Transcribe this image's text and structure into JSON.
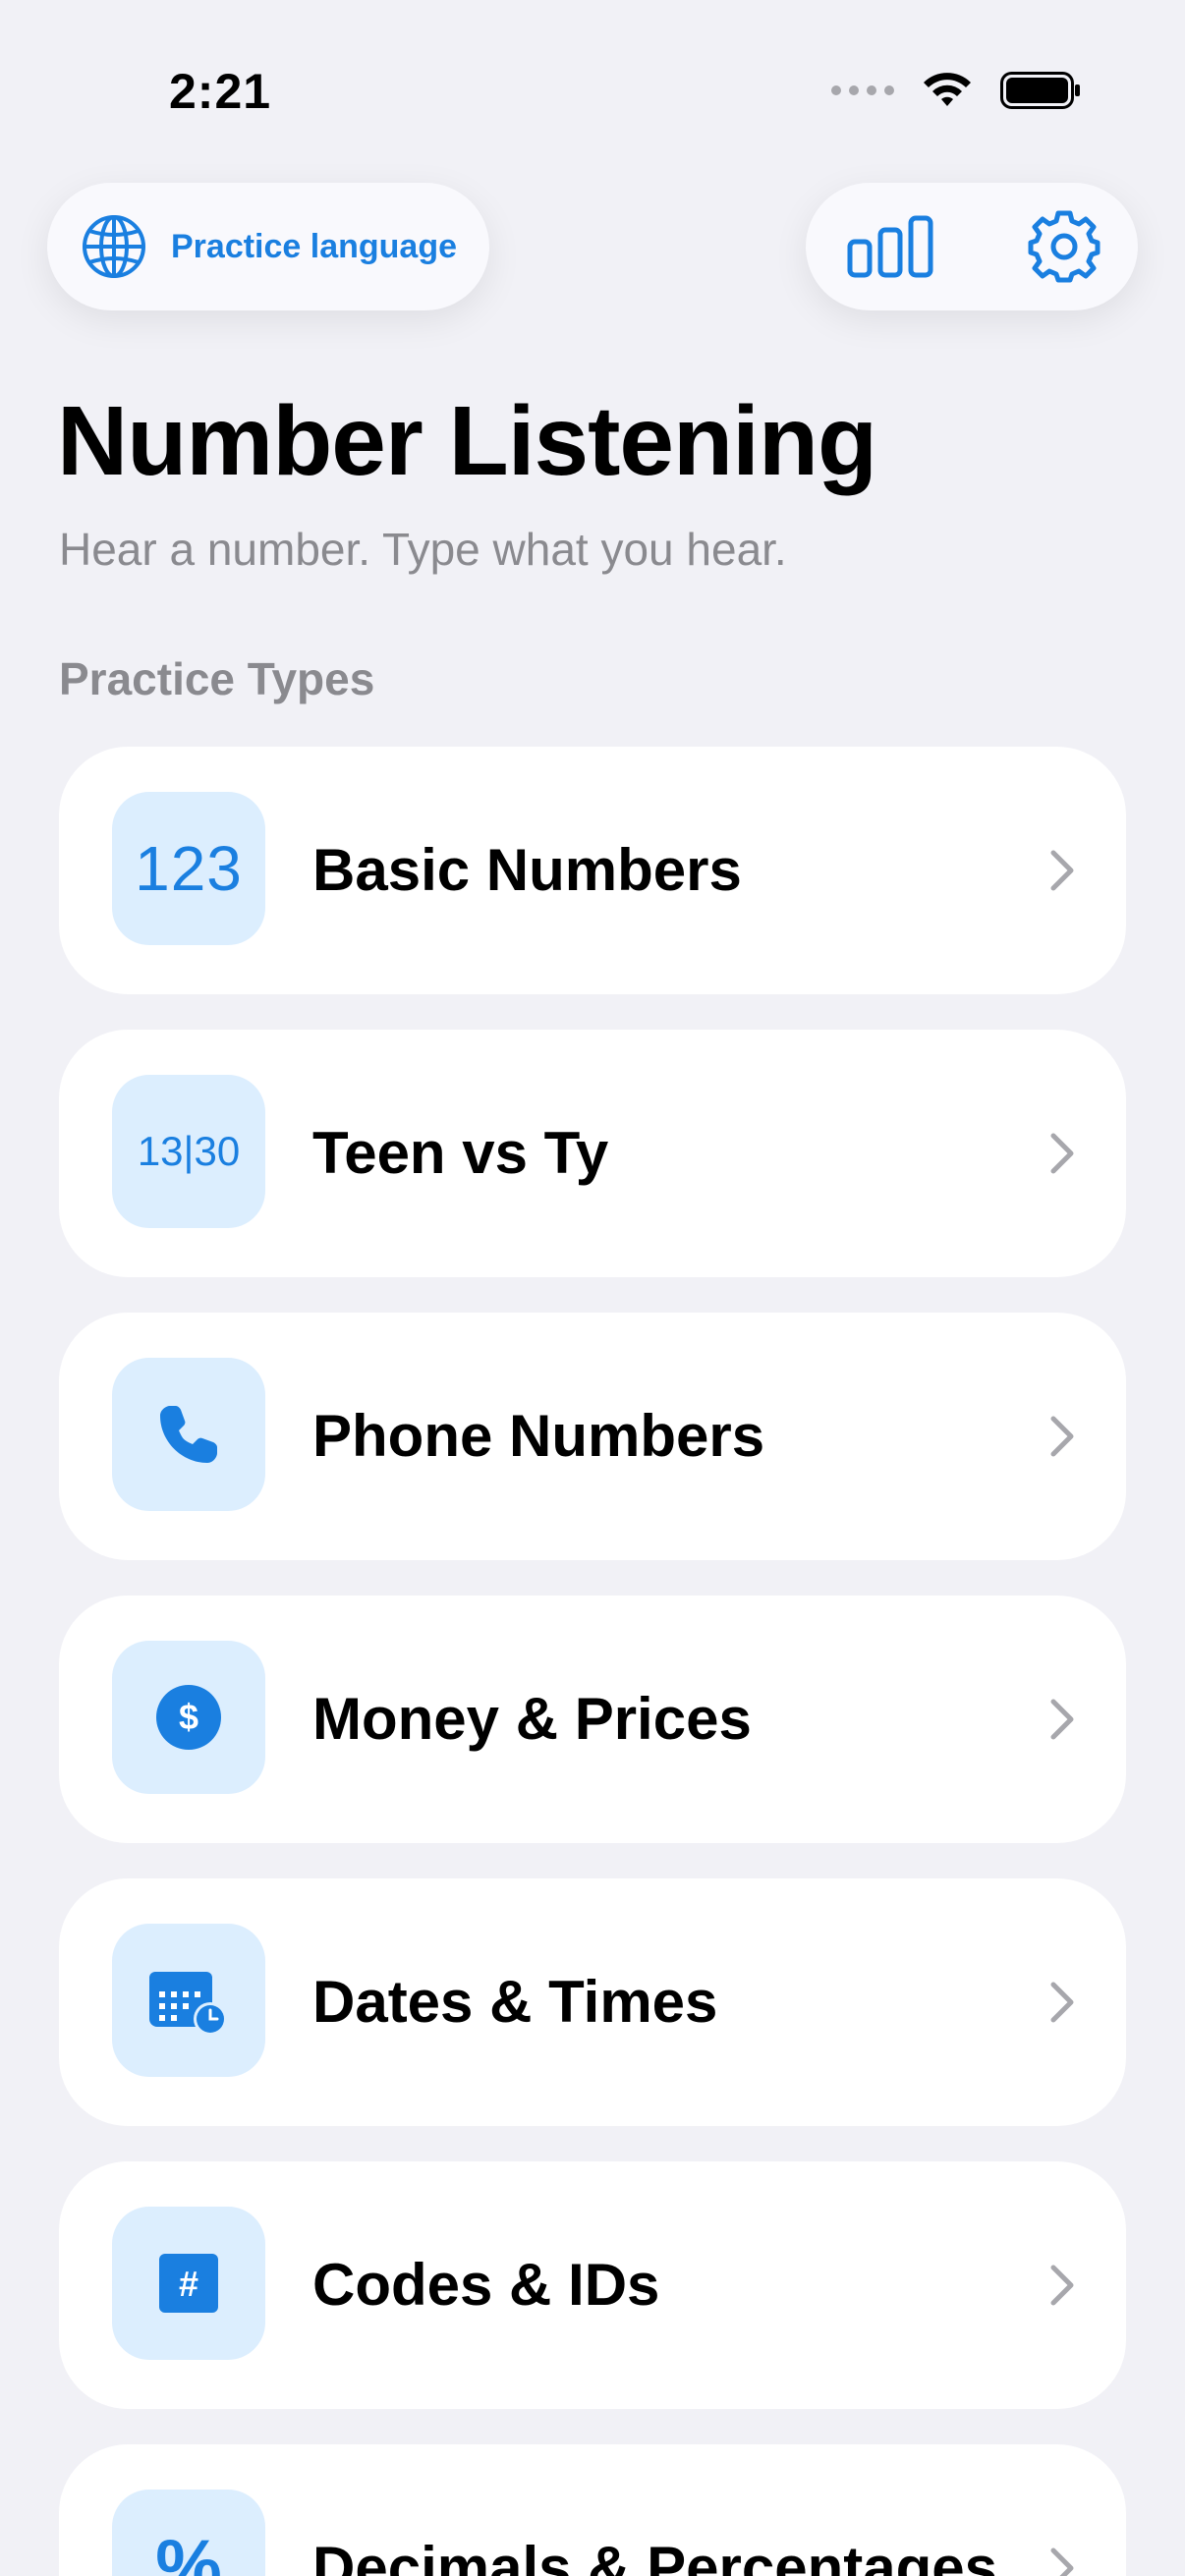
{
  "status_bar": {
    "time": "2:21"
  },
  "header": {
    "practice_language_label": "Practice language",
    "title": "Number Listening",
    "subtitle": "Hear a number. Type what you hear."
  },
  "section": {
    "title": "Practice Types"
  },
  "practice_types": [
    {
      "label": "Basic Numbers",
      "icon": "123-icon",
      "icon_text": "123"
    },
    {
      "label": "Teen vs Ty",
      "icon": "teen-vs-ty-icon",
      "icon_text": "13|30"
    },
    {
      "label": "Phone Numbers",
      "icon": "phone-icon"
    },
    {
      "label": "Money & Prices",
      "icon": "dollar-circle-icon",
      "icon_text": "$"
    },
    {
      "label": "Dates & Times",
      "icon": "calendar-clock-icon"
    },
    {
      "label": "Codes & IDs",
      "icon": "hashtag-square-icon",
      "icon_text": "#"
    },
    {
      "label": "Decimals & Percentages",
      "icon": "percent-icon",
      "icon_text": "%"
    }
  ],
  "colors": {
    "accent": "#1A7FE0",
    "tile_background": "#DCEEFE",
    "background": "#F1F1F6",
    "secondary_text": "#8A8A8F"
  }
}
